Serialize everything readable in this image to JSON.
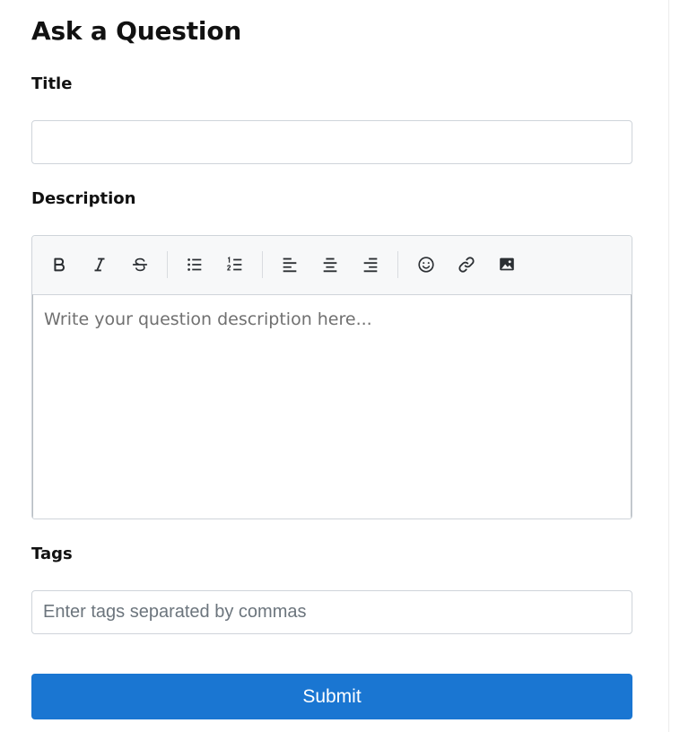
{
  "form": {
    "heading": "Ask a Question",
    "title": {
      "label": "Title",
      "value": "",
      "placeholder": ""
    },
    "description": {
      "label": "Description",
      "placeholder": "Write your question description here..."
    },
    "toolbar": [
      {
        "name": "bold-icon"
      },
      {
        "name": "italic-icon"
      },
      {
        "name": "strikethrough-icon"
      },
      {
        "name": "bullet-list-icon"
      },
      {
        "name": "numbered-list-icon"
      },
      {
        "name": "align-left-icon"
      },
      {
        "name": "align-center-icon"
      },
      {
        "name": "align-right-icon"
      },
      {
        "name": "emoji-icon"
      },
      {
        "name": "link-icon"
      },
      {
        "name": "image-icon"
      }
    ],
    "tags": {
      "label": "Tags",
      "placeholder": "Enter tags separated by commas"
    },
    "submit_label": "Submit"
  },
  "colors": {
    "accent": "#1a76d2",
    "border": "#cfd4da",
    "toolbar_bg": "#f7f8f9",
    "placeholder": "#6c757d"
  }
}
